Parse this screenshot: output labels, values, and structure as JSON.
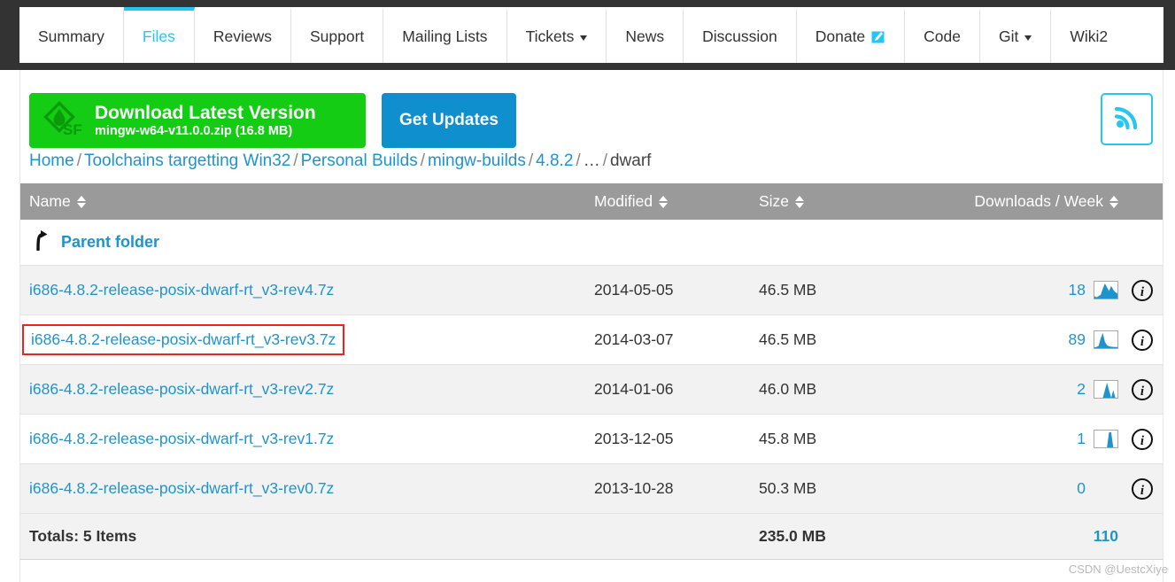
{
  "nav": {
    "tabs": [
      {
        "label": "Summary",
        "active": false,
        "caret": false,
        "icon": null
      },
      {
        "label": "Files",
        "active": true,
        "caret": false,
        "icon": null
      },
      {
        "label": "Reviews",
        "active": false,
        "caret": false,
        "icon": null
      },
      {
        "label": "Support",
        "active": false,
        "caret": false,
        "icon": null
      },
      {
        "label": "Mailing Lists",
        "active": false,
        "caret": false,
        "icon": null
      },
      {
        "label": "Tickets",
        "active": false,
        "caret": true,
        "icon": null
      },
      {
        "label": "News",
        "active": false,
        "caret": false,
        "icon": null
      },
      {
        "label": "Discussion",
        "active": false,
        "caret": false,
        "icon": null
      },
      {
        "label": "Donate",
        "active": false,
        "caret": false,
        "icon": "external-link-icon"
      },
      {
        "label": "Code",
        "active": false,
        "caret": false,
        "icon": null
      },
      {
        "label": "Git",
        "active": false,
        "caret": true,
        "icon": null
      },
      {
        "label": "Wiki2",
        "active": false,
        "caret": false,
        "icon": null
      }
    ]
  },
  "actions": {
    "download_title": "Download Latest Version",
    "download_subtitle": "mingw-w64-v11.0.0.zip (16.8 MB)",
    "get_updates_label": "Get Updates",
    "rss_icon": "rss-feed-icon"
  },
  "breadcrumb": {
    "items": [
      {
        "label": "Home",
        "link": true
      },
      {
        "label": "Toolchains targetting Win32",
        "link": true
      },
      {
        "label": "Personal Builds",
        "link": true
      },
      {
        "label": "mingw-builds",
        "link": true
      },
      {
        "label": "4.8.2",
        "link": true
      },
      {
        "label": "…",
        "link": false
      },
      {
        "label": "dwarf",
        "link": false
      }
    ],
    "separator": "/"
  },
  "table": {
    "columns": [
      {
        "label": "Name",
        "sortable": true
      },
      {
        "label": "Modified",
        "sortable": true
      },
      {
        "label": "Size",
        "sortable": true
      },
      {
        "label": "Downloads / Week",
        "sortable": true
      }
    ],
    "parent_folder_label": "Parent folder",
    "rows": [
      {
        "name": "i686-4.8.2-release-posix-dwarf-rt_v3-rev4.7z",
        "modified": "2014-05-05",
        "size": "46.5 MB",
        "downloads": "18",
        "sparkline": [
          2,
          1,
          2,
          3,
          8,
          12,
          9,
          6,
          10,
          7,
          5,
          4
        ],
        "has_sparkline": true,
        "highlighted": false,
        "info_icon": "info-circle-icon"
      },
      {
        "name": "i686-4.8.2-release-posix-dwarf-rt_v3-rev3.7z",
        "modified": "2014-03-07",
        "size": "46.5 MB",
        "downloads": "89",
        "sparkline": [
          5,
          8,
          14,
          62,
          95,
          40,
          18,
          12,
          9,
          8,
          7,
          7
        ],
        "has_sparkline": true,
        "highlighted": true,
        "info_icon": "info-circle-icon"
      },
      {
        "name": "i686-4.8.2-release-posix-dwarf-rt_v3-rev2.7z",
        "modified": "2014-01-06",
        "size": "46.0 MB",
        "downloads": "2",
        "sparkline": [
          0,
          0,
          0,
          0,
          0,
          1,
          2,
          1,
          0,
          1,
          0,
          0
        ],
        "has_sparkline": true,
        "highlighted": false,
        "info_icon": "info-circle-icon"
      },
      {
        "name": "i686-4.8.2-release-posix-dwarf-rt_v3-rev1.7z",
        "modified": "2013-12-05",
        "size": "45.8 MB",
        "downloads": "1",
        "sparkline": [
          0,
          0,
          0,
          0,
          0,
          0,
          0,
          1,
          1,
          0,
          0,
          0
        ],
        "has_sparkline": true,
        "highlighted": false,
        "info_icon": "info-circle-icon"
      },
      {
        "name": "i686-4.8.2-release-posix-dwarf-rt_v3-rev0.7z",
        "modified": "2013-10-28",
        "size": "50.3 MB",
        "downloads": "0",
        "sparkline": [],
        "has_sparkline": false,
        "highlighted": false,
        "info_icon": "info-circle-icon"
      }
    ],
    "totals": {
      "label": "Totals: 5 Items",
      "modified": "",
      "size": "235.0 MB",
      "downloads": "110"
    }
  },
  "watermark": "CSDN @UestcXiye",
  "colors": {
    "accent_cyan": "#26c6f3",
    "link_blue": "#1f94cc",
    "download_green": "#14cc14",
    "updates_blue": "#0f8fce",
    "header_gray": "#9a9a9a",
    "dark_bar": "#333333",
    "highlight_red": "#e8251f"
  }
}
